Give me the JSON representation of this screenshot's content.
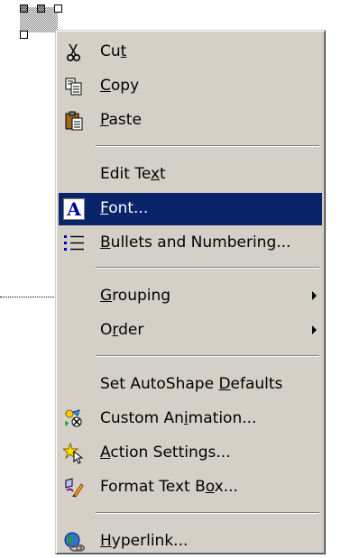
{
  "menu": {
    "items": [
      {
        "id": "cut",
        "label": "Cut",
        "ul": 2,
        "icon": "scissors-icon"
      },
      {
        "id": "copy",
        "label": "Copy",
        "ul": 0,
        "icon": "copy-icon"
      },
      {
        "id": "paste",
        "label": "Paste",
        "ul": 0,
        "icon": "paste-icon"
      },
      {
        "id": "edit-text",
        "label": "Edit Text",
        "ul": 7,
        "icon": ""
      },
      {
        "id": "font",
        "label": "Font...",
        "ul": 0,
        "icon": "font-icon",
        "highlighted": true
      },
      {
        "id": "bullets",
        "label": "Bullets and Numbering...",
        "ul": 0,
        "icon": "bullets-icon"
      },
      {
        "id": "grouping",
        "label": "Grouping",
        "ul": 0,
        "icon": "",
        "submenu": true
      },
      {
        "id": "order",
        "label": "Order",
        "ul": 1,
        "icon": "",
        "submenu": true
      },
      {
        "id": "autoshape-defaults",
        "label": "Set AutoShape Defaults",
        "ul": 14,
        "icon": ""
      },
      {
        "id": "custom-animation",
        "label": "Custom Animation...",
        "ul": 9,
        "icon": "animation-icon"
      },
      {
        "id": "action-settings",
        "label": "Action Settings...",
        "ul": 0,
        "icon": "action-icon"
      },
      {
        "id": "format-text-box",
        "label": "Format Text Box...",
        "ul": 13,
        "icon": "format-icon"
      },
      {
        "id": "hyperlink",
        "label": "Hyperlink...",
        "ul": 0,
        "icon": "hyperlink-icon"
      }
    ]
  },
  "colors": {
    "menu_bg": "#d4d0c8",
    "highlight_bg": "#0a246a",
    "highlight_text": "#ffffff"
  }
}
